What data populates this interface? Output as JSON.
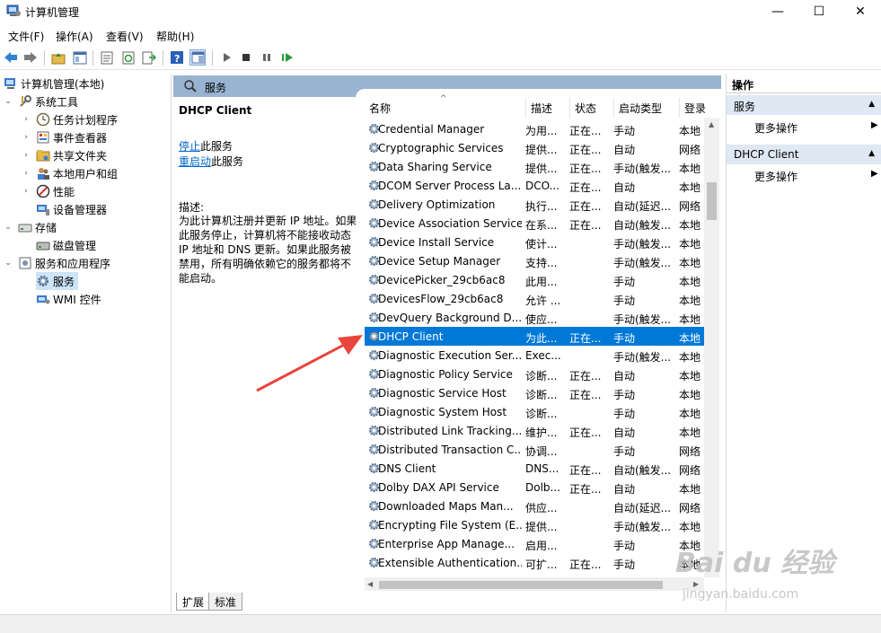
{
  "window": {
    "title": "计算机管理",
    "minimize": "—",
    "maximize": "☐",
    "close": "✕"
  },
  "menu": [
    "文件(F)",
    "操作(A)",
    "查看(V)",
    "帮助(H)"
  ],
  "tree": {
    "root": "计算机管理(本地)",
    "system_tools": "系统工具",
    "task_scheduler": "任务计划程序",
    "event_viewer": "事件查看器",
    "shared_folders": "共享文件夹",
    "local_users": "本地用户和组",
    "performance": "性能",
    "device_manager": "设备管理器",
    "storage": "存储",
    "disk_management": "磁盘管理",
    "services_apps": "服务和应用程序",
    "services": "服务",
    "wmi": "WMI 控件"
  },
  "center": {
    "header": "服务",
    "selected_service": "DHCP Client",
    "stop_link": "停止",
    "stop_suffix": "此服务",
    "restart_link": "重启动",
    "restart_suffix": "此服务",
    "desc_label": "描述:",
    "desc_text": "为此计算机注册并更新 IP 地址。如果此服务停止，计算机将不能接收动态 IP 地址和 DNS 更新。如果此服务被禁用，所有明确依赖它的服务都将不能启动。",
    "columns": [
      "名称",
      "描述",
      "状态",
      "启动类型",
      "登录"
    ],
    "rows": [
      {
        "name": "Credential Manager",
        "desc": "为用...",
        "status": "正在...",
        "startup": "手动",
        "logon": "本地"
      },
      {
        "name": "Cryptographic Services",
        "desc": "提供...",
        "status": "正在...",
        "startup": "自动",
        "logon": "网络"
      },
      {
        "name": "Data Sharing Service",
        "desc": "提供...",
        "status": "正在...",
        "startup": "手动(触发...",
        "logon": "本地"
      },
      {
        "name": "DCOM Server Process La...",
        "desc": "DCO...",
        "status": "正在...",
        "startup": "自动",
        "logon": "本地"
      },
      {
        "name": "Delivery Optimization",
        "desc": "执行...",
        "status": "正在...",
        "startup": "自动(延迟...",
        "logon": "网络"
      },
      {
        "name": "Device Association Service",
        "desc": "在系...",
        "status": "正在...",
        "startup": "自动(触发...",
        "logon": "本地"
      },
      {
        "name": "Device Install Service",
        "desc": "使计...",
        "status": "",
        "startup": "手动(触发...",
        "logon": "本地"
      },
      {
        "name": "Device Setup Manager",
        "desc": "支持...",
        "status": "",
        "startup": "手动(触发...",
        "logon": "本地"
      },
      {
        "name": "DevicePicker_29cb6ac8",
        "desc": "此用...",
        "status": "",
        "startup": "手动",
        "logon": "本地"
      },
      {
        "name": "DevicesFlow_29cb6ac8",
        "desc": "允许 ...",
        "status": "",
        "startup": "手动",
        "logon": "本地"
      },
      {
        "name": "DevQuery Background D...",
        "desc": "使应...",
        "status": "",
        "startup": "手动(触发...",
        "logon": "本地"
      },
      {
        "name": "DHCP Client",
        "desc": "为此...",
        "status": "正在...",
        "startup": "手动",
        "logon": "本地"
      },
      {
        "name": "Diagnostic Execution Ser...",
        "desc": "Exec...",
        "status": "",
        "startup": "手动(触发...",
        "logon": "本地"
      },
      {
        "name": "Diagnostic Policy Service",
        "desc": "诊断...",
        "status": "正在...",
        "startup": "自动",
        "logon": "本地"
      },
      {
        "name": "Diagnostic Service Host",
        "desc": "诊断...",
        "status": "正在...",
        "startup": "手动",
        "logon": "本地"
      },
      {
        "name": "Diagnostic System Host",
        "desc": "诊断...",
        "status": "",
        "startup": "手动",
        "logon": "本地"
      },
      {
        "name": "Distributed Link Tracking...",
        "desc": "维护...",
        "status": "正在...",
        "startup": "自动",
        "logon": "本地"
      },
      {
        "name": "Distributed Transaction C...",
        "desc": "协调...",
        "status": "",
        "startup": "手动",
        "logon": "网络"
      },
      {
        "name": "DNS Client",
        "desc": "DNS...",
        "status": "正在...",
        "startup": "自动(触发...",
        "logon": "网络"
      },
      {
        "name": "Dolby DAX API Service",
        "desc": "Dolb...",
        "status": "正在...",
        "startup": "自动",
        "logon": "本地"
      },
      {
        "name": "Downloaded Maps Man...",
        "desc": "供应...",
        "status": "",
        "startup": "自动(延迟...",
        "logon": "网络"
      },
      {
        "name": "Encrypting File System (E...",
        "desc": "提供...",
        "status": "",
        "startup": "手动(触发...",
        "logon": "本地"
      },
      {
        "name": "Enterprise App Manage...",
        "desc": "启用...",
        "status": "",
        "startup": "手动",
        "logon": "本地"
      },
      {
        "name": "Extensible Authentication...",
        "desc": "可扩...",
        "status": "正在...",
        "startup": "手动",
        "logon": "本地"
      }
    ],
    "tab_extended": "扩展",
    "tab_standard": "标准"
  },
  "actions": {
    "header": "操作",
    "sec1": "服务",
    "more1": "更多操作",
    "sec2": "DHCP Client",
    "more2": "更多操作"
  },
  "watermark": {
    "line1": "Bai du 经验",
    "line2": "jingyan.baidu.com"
  },
  "colors": {
    "selection": "#0078d7",
    "header_band": "#99b4d1",
    "link": "#0066cc",
    "arrow": "#e8453c"
  }
}
